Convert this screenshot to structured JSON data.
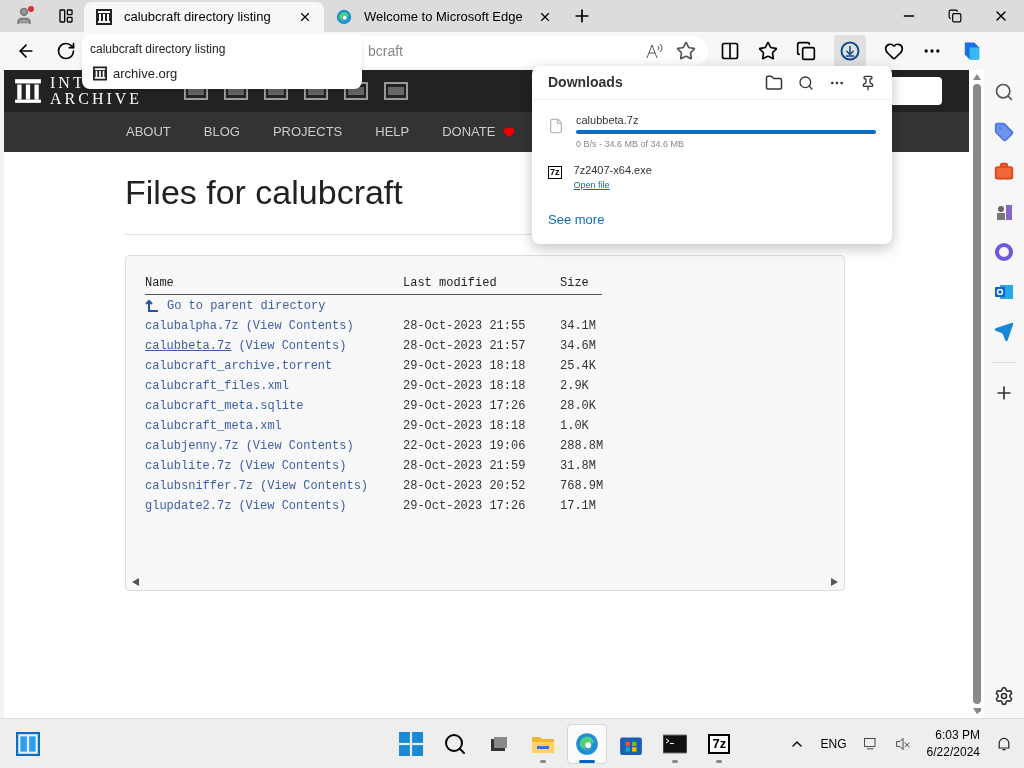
{
  "tabs": [
    {
      "title": "calubcraft directory listing",
      "selected": true
    },
    {
      "title": "Welcome to Microsoft Edge",
      "selected": false
    }
  ],
  "tab_tooltip": {
    "title": "calubcraft directory listing",
    "site": "archive.org"
  },
  "address_bar": {
    "value": "bcraft"
  },
  "site": {
    "logo_lines": [
      "INT",
      "ARCHIVE"
    ],
    "nav": [
      {
        "label": "ABOUT",
        "heart": false
      },
      {
        "label": "BLOG",
        "heart": false
      },
      {
        "label": "PROJECTS",
        "heart": false
      },
      {
        "label": "HELP",
        "heart": false
      },
      {
        "label": "DONATE",
        "heart": true
      }
    ]
  },
  "heading": "Files for calubcraft",
  "table": {
    "columns": [
      "Name",
      "Last modified",
      "Size"
    ],
    "parent_link": "Go to parent directory",
    "rows": [
      {
        "name": "calubalpha.7z",
        "contents": "(View Contents)",
        "modified": "28-Oct-2023 21:55",
        "size": "34.1M",
        "hovered": false
      },
      {
        "name": "calubbeta.7z",
        "contents": "(View Contents)",
        "modified": "28-Oct-2023 21:57",
        "size": "34.6M",
        "hovered": true
      },
      {
        "name": "calubcraft_archive.torrent",
        "modified": "29-Oct-2023 18:18",
        "size": "25.4K",
        "hovered": false
      },
      {
        "name": "calubcraft_files.xml",
        "modified": "29-Oct-2023 18:18",
        "size": "2.9K",
        "hovered": false
      },
      {
        "name": "calubcraft_meta.sqlite",
        "modified": "29-Oct-2023 17:26",
        "size": "28.0K",
        "hovered": false
      },
      {
        "name": "calubcraft_meta.xml",
        "modified": "29-Oct-2023 18:18",
        "size": "1.0K",
        "hovered": false
      },
      {
        "name": "calubjenny.7z",
        "contents": "(View Contents)",
        "modified": "22-Oct-2023 19:06",
        "size": "288.8M",
        "hovered": false
      },
      {
        "name": "calublite.7z",
        "contents": "(View Contents)",
        "modified": "28-Oct-2023 21:59",
        "size": "31.8M",
        "hovered": false
      },
      {
        "name": "calubsniffer.7z",
        "contents": "(View Contents)",
        "modified": "28-Oct-2023 20:52",
        "size": "768.9M",
        "hovered": false
      },
      {
        "name": "glupdate2.7z",
        "contents": "(View Contents)",
        "modified": "29-Oct-2023 17:26",
        "size": "17.1M",
        "hovered": false
      }
    ]
  },
  "downloads": {
    "title": "Downloads",
    "items": [
      {
        "kind": "progress",
        "name": "calubbeta.7z",
        "status": "0 B/s - 34.6 MB of 34.6 MB",
        "level": 1.0
      },
      {
        "kind": "done",
        "name": "7z2407-x64.exe",
        "icon_text": "7z",
        "action": "Open file"
      }
    ],
    "see_more": "See more"
  },
  "taskbar": {
    "items": [
      {
        "kind": "start",
        "running": false,
        "active": false
      },
      {
        "kind": "search",
        "running": false,
        "active": false
      },
      {
        "kind": "taskview",
        "running": false,
        "active": false
      },
      {
        "kind": "folder",
        "running": true,
        "active": false
      },
      {
        "kind": "edge",
        "running": true,
        "active": true
      },
      {
        "kind": "store",
        "running": false,
        "active": false
      },
      {
        "kind": "terminal",
        "running": true,
        "active": false
      },
      {
        "kind": "sevenzip",
        "label": "7z",
        "running": true,
        "active": false
      }
    ],
    "language": "ENG",
    "time": "6:03 PM",
    "date": "6/22/2024"
  }
}
